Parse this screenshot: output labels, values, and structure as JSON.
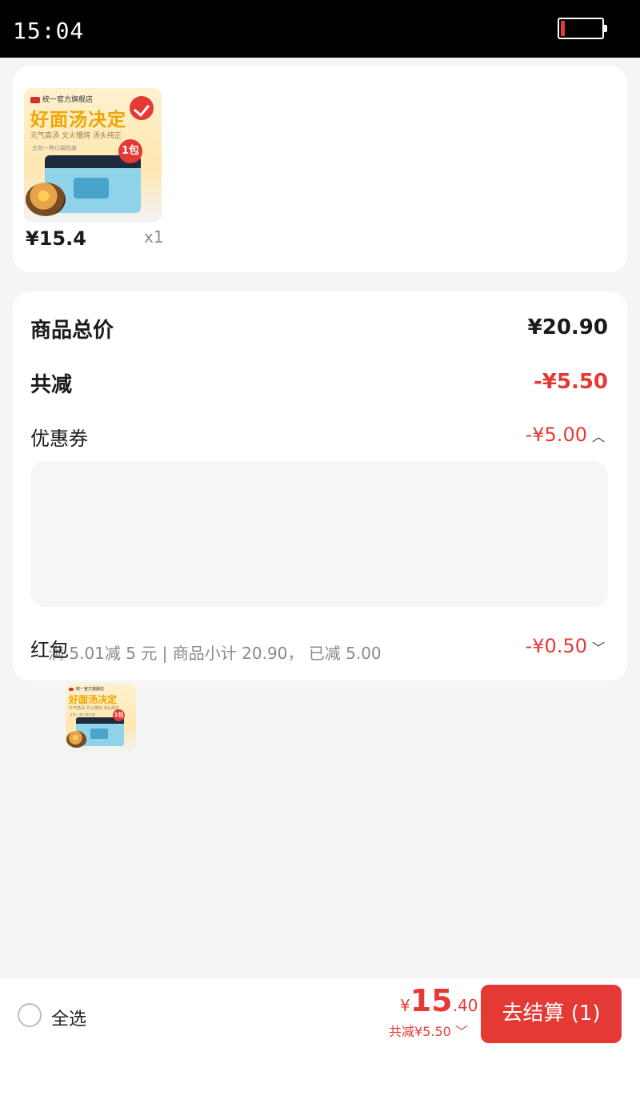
{
  "status_bar": {
    "time": "15:04"
  },
  "product": {
    "image": {
      "shop": "统一官方旗舰店",
      "headline": "好面汤决定",
      "subline": "元气高汤 文火慢炖 汤头纯正",
      "note": "五包一养口袋包装",
      "badge": "1包"
    },
    "price": "¥15.4",
    "quantity": "x1"
  },
  "summary": {
    "total_label": "商品总价",
    "total_value": "¥20.90",
    "reduce_label": "共减",
    "reduce_value": "-¥5.50",
    "coupon_label": "优惠券",
    "coupon_value": "-¥5.00",
    "coupon_detail": "满 5.01减 5 元 | 商品小计 20.90， 已减 5.00",
    "coupon_image": {
      "shop": "统一官方旗舰店",
      "headline": "好面汤决定",
      "subline": "元气高汤 文火慢炖 汤头纯正",
      "note": "五包一养口袋包装",
      "badge": "1包"
    },
    "redpack_label": "红包",
    "redpack_value": "-¥0.50"
  },
  "bottom_bar": {
    "select_all_label": "全选",
    "total_currency": "¥",
    "total_integer": "15",
    "total_decimal": ".40",
    "total_reduce": "共减¥5.50",
    "checkout_label": "去结算 (1)"
  },
  "colors": {
    "accent": "#e53935",
    "background": "#f5f5f5",
    "card": "#ffffff"
  }
}
